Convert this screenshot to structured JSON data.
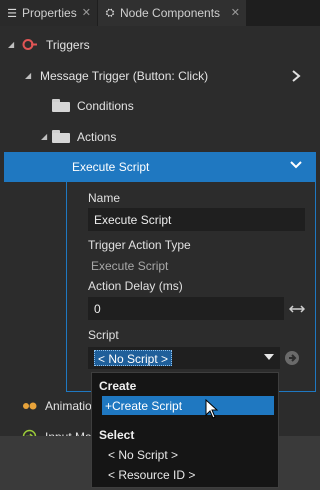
{
  "tabs": [
    {
      "label": "Properties",
      "icon": "list-icon",
      "close": "✕"
    },
    {
      "label": "Node Components",
      "icon": "node-components-icon",
      "close": "✕"
    }
  ],
  "tree": {
    "triggers": "Triggers",
    "message_trigger": "Message Trigger (Button: Click)",
    "conditions": "Conditions",
    "actions": "Actions",
    "execute_script": "Execute Script",
    "animation": "Animatio",
    "input_manipulator": "Input Ma"
  },
  "properties": {
    "name_label": "Name",
    "name_value": "Execute Script",
    "trigger_action_type_label": "Trigger Action Type",
    "trigger_action_type_value": "Execute Script",
    "action_delay_label": "Action Delay (ms)",
    "action_delay_value": "0",
    "script_label": "Script",
    "script_value": "< No Script >"
  },
  "popup": {
    "create_header": "Create",
    "create_script": "+Create Script",
    "select_header": "Select",
    "no_script": "< No Script >",
    "resource_id": "< Resource ID >"
  },
  "colors": {
    "accent": "#1f78c1",
    "trigger_icon": "#e05555",
    "animation_icon": "#e8a33a",
    "input_icon": "#9ccc3a"
  }
}
